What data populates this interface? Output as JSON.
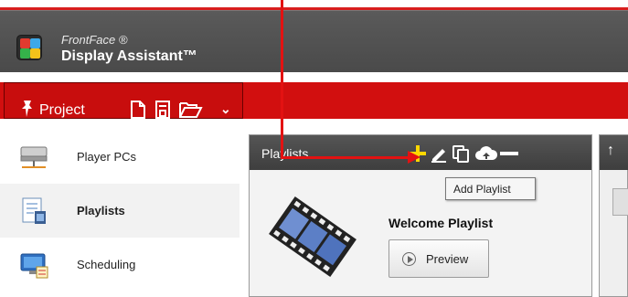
{
  "app": {
    "brand": "FrontFace ®",
    "title": "Display Assistant™"
  },
  "project_toolbar": {
    "label": "Project",
    "icons": [
      "pin-icon",
      "new-document-icon",
      "save-icon",
      "open-folder-icon",
      "chevron-down-icon"
    ]
  },
  "sidebar": {
    "items": [
      {
        "label": "Player PCs",
        "icon": "player-pc-icon",
        "active": false
      },
      {
        "label": "Playlists",
        "icon": "playlists-icon",
        "active": true
      },
      {
        "label": "Scheduling",
        "icon": "scheduling-icon",
        "active": false
      }
    ]
  },
  "playlists_panel": {
    "title": "Playlists",
    "header_icons": [
      "add-icon",
      "edit-icon",
      "duplicate-icon",
      "cloud-upload-icon",
      "remove-icon"
    ],
    "tooltip": "Add Playlist",
    "items": [
      {
        "name": "Welcome Playlist",
        "preview_label": "Preview"
      }
    ]
  },
  "colors": {
    "accent_red": "#d20f0f",
    "annotation_red": "#e31212",
    "add_icon_yellow": "#ffd800",
    "titlebar_gray": "#4f4f4f"
  }
}
